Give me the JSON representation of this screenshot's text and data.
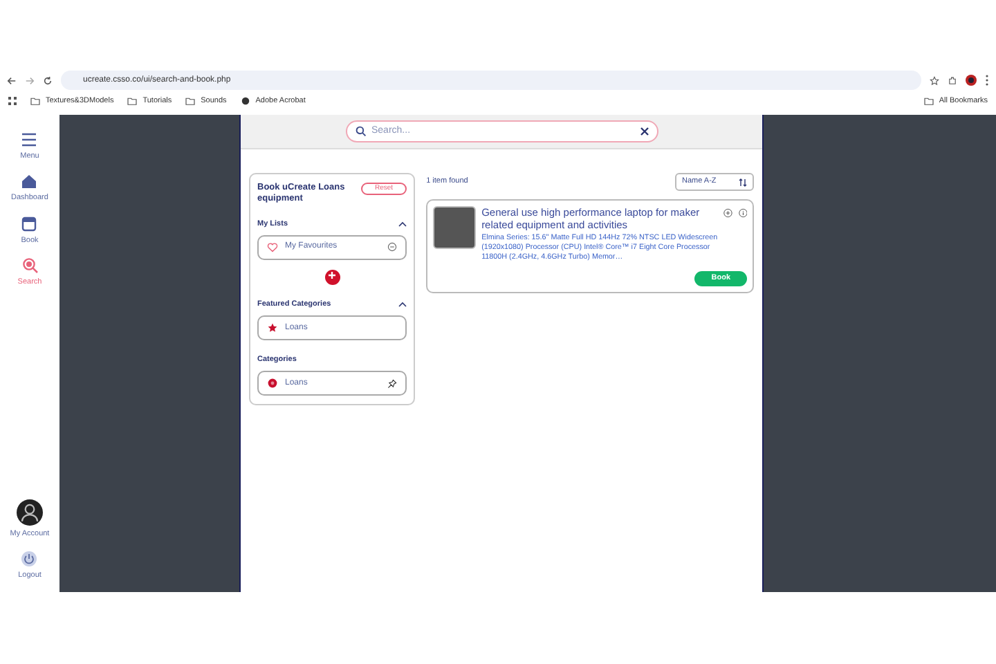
{
  "browser": {
    "url": "ucreate.csso.co/ui/search-and-book.php",
    "bookmarks": [
      "Textures&3DModels",
      "Tutorials",
      "Sounds",
      "Adobe Acrobat"
    ],
    "all_bookmarks": "All Bookmarks"
  },
  "nav": {
    "items": [
      {
        "label": "Menu",
        "kind": "menu",
        "selected": false
      },
      {
        "label": "Dashboard",
        "kind": "home",
        "selected": false
      },
      {
        "label": "Book",
        "kind": "book",
        "selected": false
      },
      {
        "label": "Search",
        "kind": "search",
        "selected": true
      }
    ],
    "bottom": [
      {
        "label": "My Account",
        "kind": "account"
      },
      {
        "label": "Logout",
        "kind": "logout"
      }
    ]
  },
  "search": {
    "placeholder": "Search..."
  },
  "filters": {
    "title": "Book uCreate Loans equipment",
    "reset": "Reset",
    "sections": [
      {
        "title": "My Lists",
        "collapsible": true,
        "items": [
          {
            "label": "My Favourites",
            "kind": "favourite"
          }
        ],
        "add_button": true
      },
      {
        "title": "Featured Categories",
        "collapsible": true,
        "items": [
          {
            "label": "Loans",
            "kind": "star"
          }
        ],
        "add_button": false
      },
      {
        "title": "Categories",
        "collapsible": false,
        "items": [
          {
            "label": "Loans",
            "kind": "category"
          }
        ],
        "add_button": false
      }
    ]
  },
  "results": {
    "count": "1 item found",
    "sort": "Name A-Z",
    "items": [
      {
        "title": "General use high performance laptop for maker related equipment and activities",
        "description": "Elmina Series: 15.6\" Matte Full HD 144Hz 72% NTSC LED Widescreen (1920x1080) Processor (CPU) Intel® Core™ i7 Eight Core Processor 11800H (2.4GHz, 4.6GHz Turbo) Memor…",
        "button": "Book"
      }
    ]
  }
}
